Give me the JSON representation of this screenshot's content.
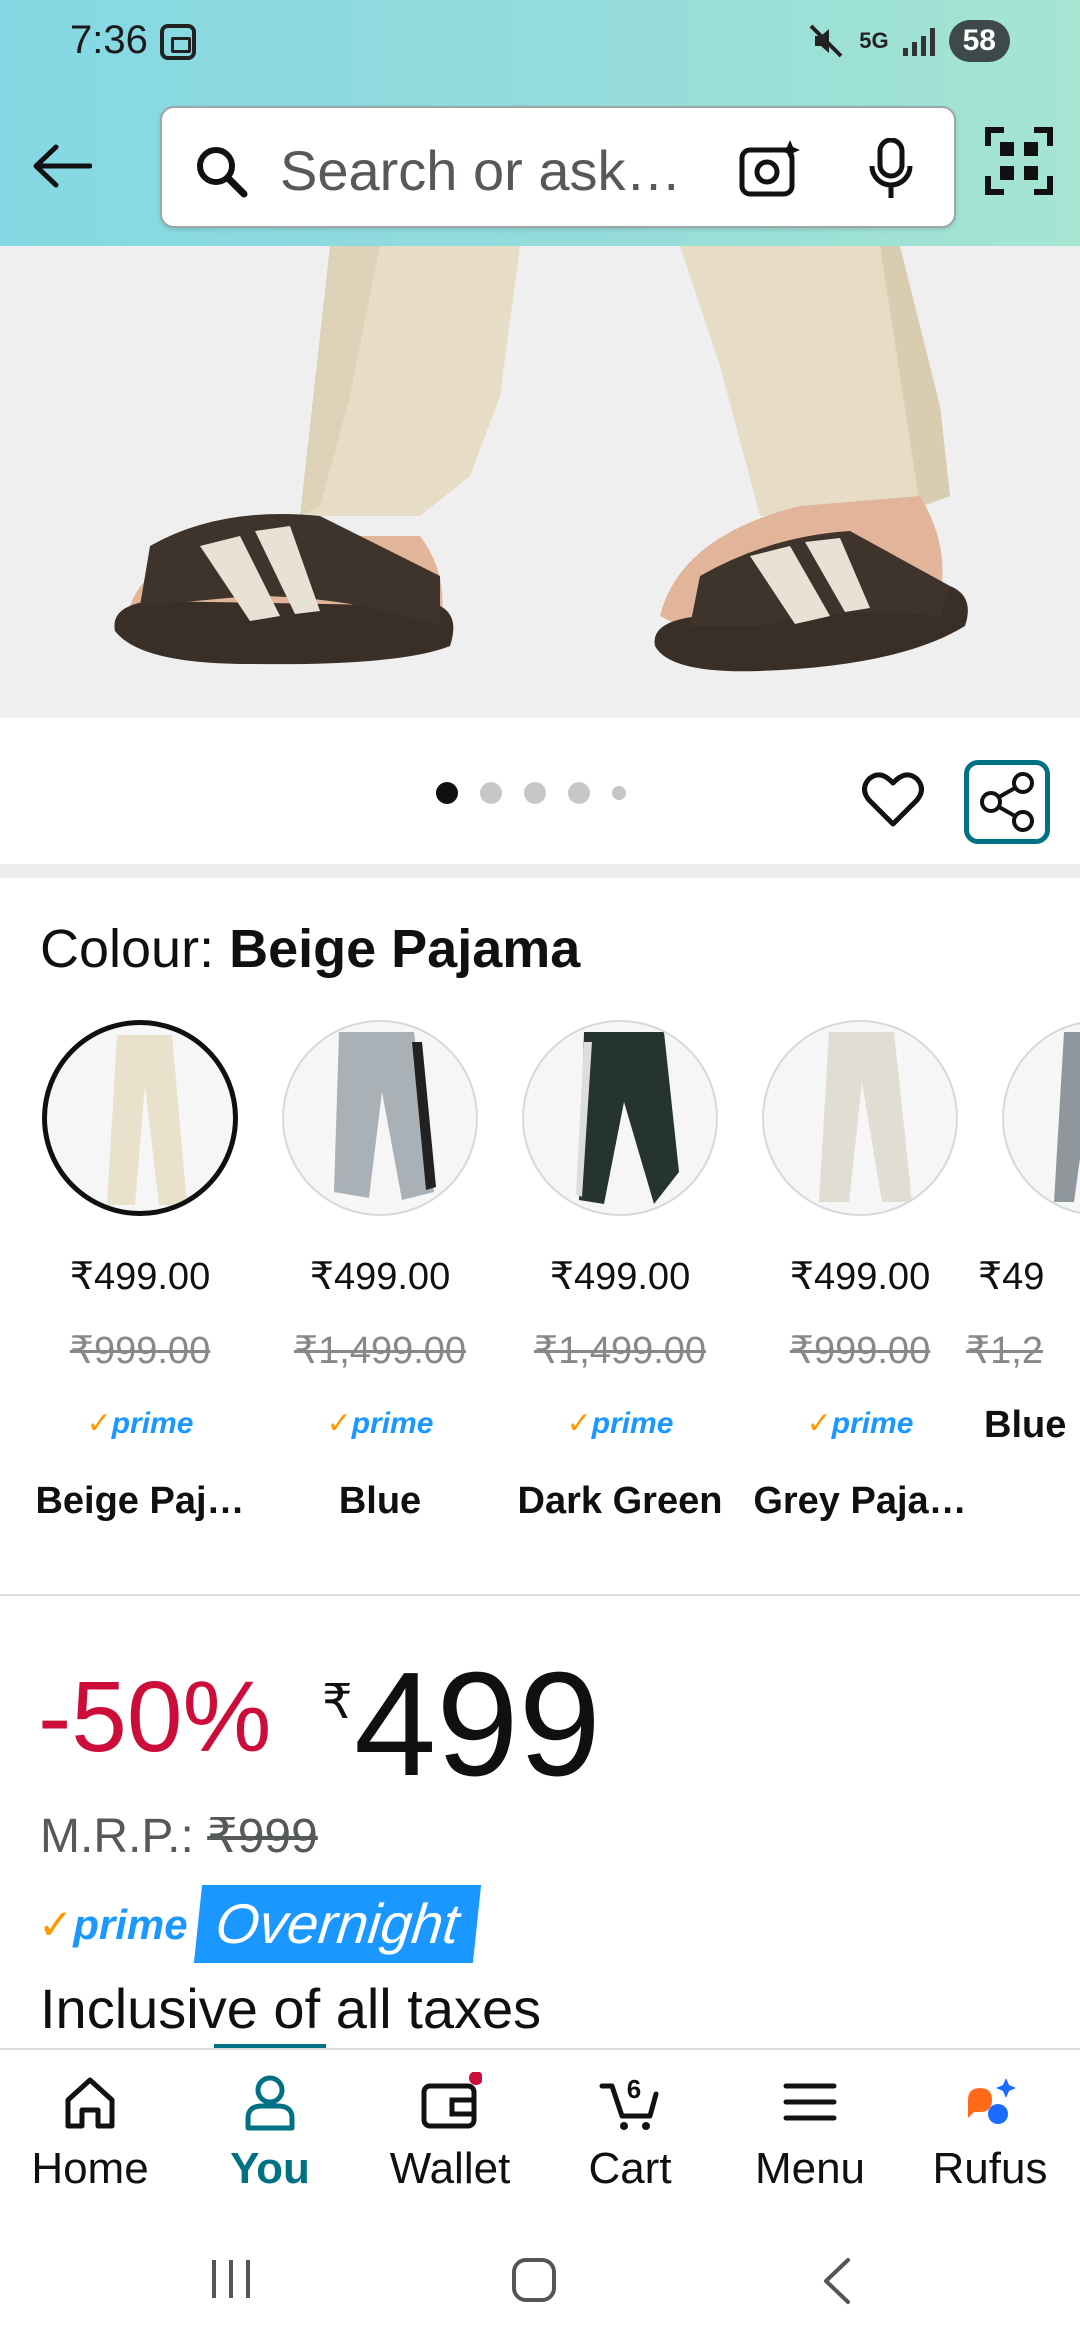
{
  "status_bar": {
    "time": "7:36",
    "network": "5G",
    "battery": "58"
  },
  "search": {
    "placeholder": "Search or ask…"
  },
  "image_carousel": {
    "page_count": 5,
    "active_index": 0
  },
  "colour": {
    "label": "Colour: ",
    "selected": "Beige Pajama"
  },
  "swatches": [
    {
      "price": "₹499.00",
      "mrp": "₹999.00",
      "prime": "prime",
      "name": "Beige Paj…",
      "color": "#e9e1cc",
      "selected": true
    },
    {
      "price": "₹499.00",
      "mrp": "₹1,499.00",
      "prime": "prime",
      "name": "Blue",
      "color": "#a9b0b6",
      "selected": false
    },
    {
      "price": "₹499.00",
      "mrp": "₹1,499.00",
      "prime": "prime",
      "name": "Dark Green",
      "color": "#263430",
      "selected": false
    },
    {
      "price": "₹499.00",
      "mrp": "₹999.00",
      "prime": "prime",
      "name": "Grey Paja…",
      "color": "#e1ddd3",
      "selected": false
    },
    {
      "price": "₹49",
      "mrp": "₹1,2",
      "prime": "",
      "name": "Blue",
      "color": "#8f979d",
      "selected": false
    }
  ],
  "pricing": {
    "discount": "-50%",
    "currency": "₹",
    "price": "499",
    "mrp_label": "M.R.P.: ",
    "mrp_value": "₹999",
    "prime": "prime",
    "delivery_badge": "Overnight",
    "tax_note": "Inclusive of all taxes"
  },
  "bottom_nav": {
    "home": "Home",
    "you": "You",
    "wallet": "Wallet",
    "cart": "Cart",
    "cart_count": "6",
    "menu": "Menu",
    "rufus": "Rufus"
  },
  "colors": {
    "accent": "#007185",
    "discount": "#cc0c39",
    "prime_blue": "#1a98ff",
    "prime_orange": "#ff9900"
  }
}
